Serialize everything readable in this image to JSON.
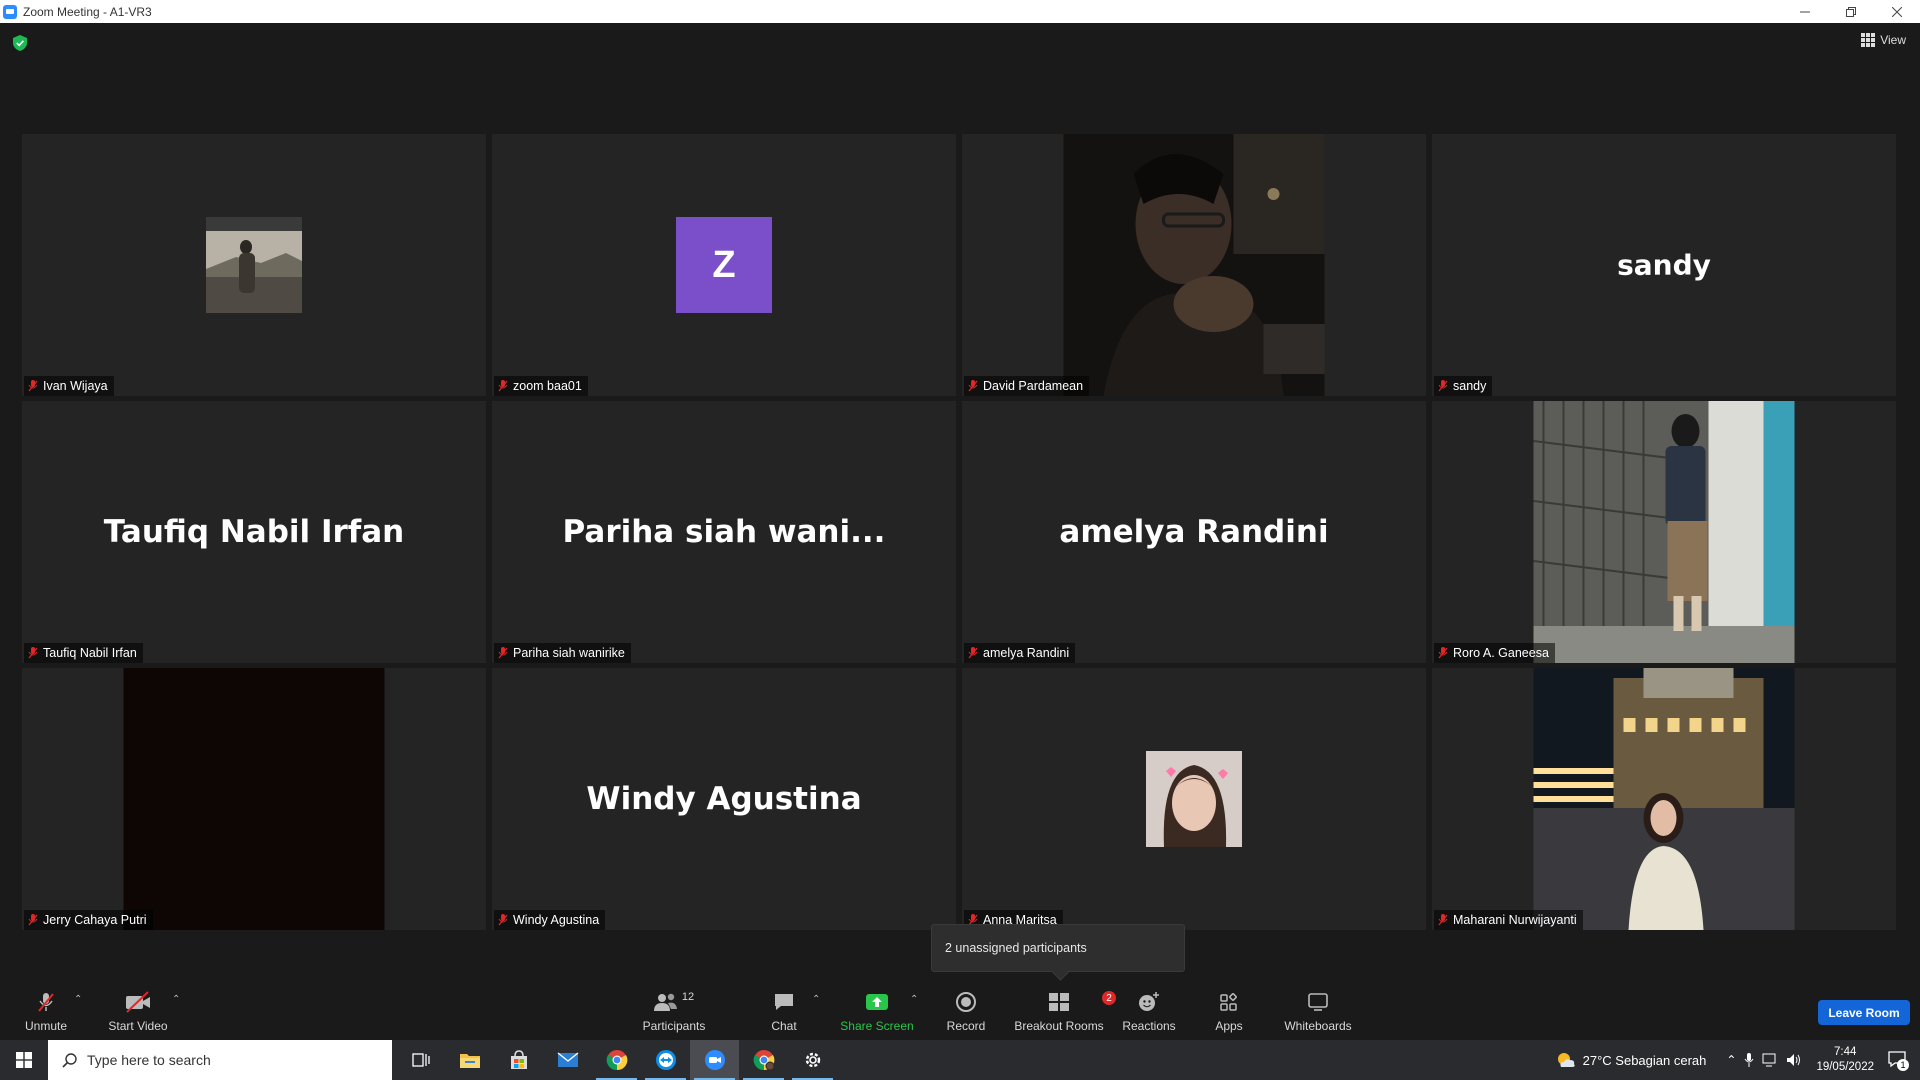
{
  "window": {
    "title": "Zoom Meeting - A1-VR3",
    "controls": [
      "minimize",
      "restore",
      "close"
    ]
  },
  "top": {
    "view_label": "View"
  },
  "participants_grid": [
    {
      "name": "Ivan Wijaya",
      "display": "photo",
      "big_name": ""
    },
    {
      "name": "zoom baa01",
      "display": "avatar",
      "avatar_letter": "Z",
      "big_name": ""
    },
    {
      "name": "David Pardamean",
      "display": "video",
      "big_name": ""
    },
    {
      "name": "sandy",
      "display": "name",
      "big_name": "sandy"
    },
    {
      "name": "Taufiq Nabil Irfan",
      "display": "name",
      "big_name": "Taufiq Nabil Irfan"
    },
    {
      "name": "Pariha siah wanirike",
      "display": "name",
      "big_name": "Pariha siah wani..."
    },
    {
      "name": "amelya Randini",
      "display": "name",
      "big_name": "amelya Randini"
    },
    {
      "name": "Roro A. Ganeesa",
      "display": "video",
      "big_name": ""
    },
    {
      "name": "Jerry Cahaya Putri",
      "display": "video-dark",
      "big_name": ""
    },
    {
      "name": "Windy Agustina",
      "display": "name",
      "big_name": "Windy Agustina"
    },
    {
      "name": "Anna Maritsa",
      "display": "photo",
      "big_name": ""
    },
    {
      "name": "Maharani Nurwijayanti",
      "display": "video",
      "big_name": ""
    }
  ],
  "tooltip": {
    "text": "2 unassigned participants"
  },
  "toolbar": {
    "unmute": "Unmute",
    "start_video": "Start Video",
    "participants": "Participants",
    "participants_count": "12",
    "chat": "Chat",
    "share_screen": "Share Screen",
    "record": "Record",
    "breakout_rooms": "Breakout Rooms",
    "breakout_badge": "2",
    "reactions": "Reactions",
    "apps": "Apps",
    "whiteboards": "Whiteboards",
    "leave": "Leave Room"
  },
  "taskbar": {
    "search_placeholder": "Type here to search",
    "apps": [
      "task-view-icon",
      "file-explorer-icon",
      "store-icon",
      "mail-icon",
      "chrome-icon",
      "teamviewer-icon",
      "zoom-icon",
      "chrome-profile-icon",
      "settings-icon"
    ],
    "weather": "27°C  Sebagian cerah",
    "time": "7:44",
    "date": "19/05/2022",
    "notification_count": "1"
  },
  "colors": {
    "accent": "#2d8cff",
    "leave": "#1465d8",
    "share_green": "#28c64a",
    "muted_red": "#e02828",
    "avatar_purple": "#7a4fc9"
  }
}
